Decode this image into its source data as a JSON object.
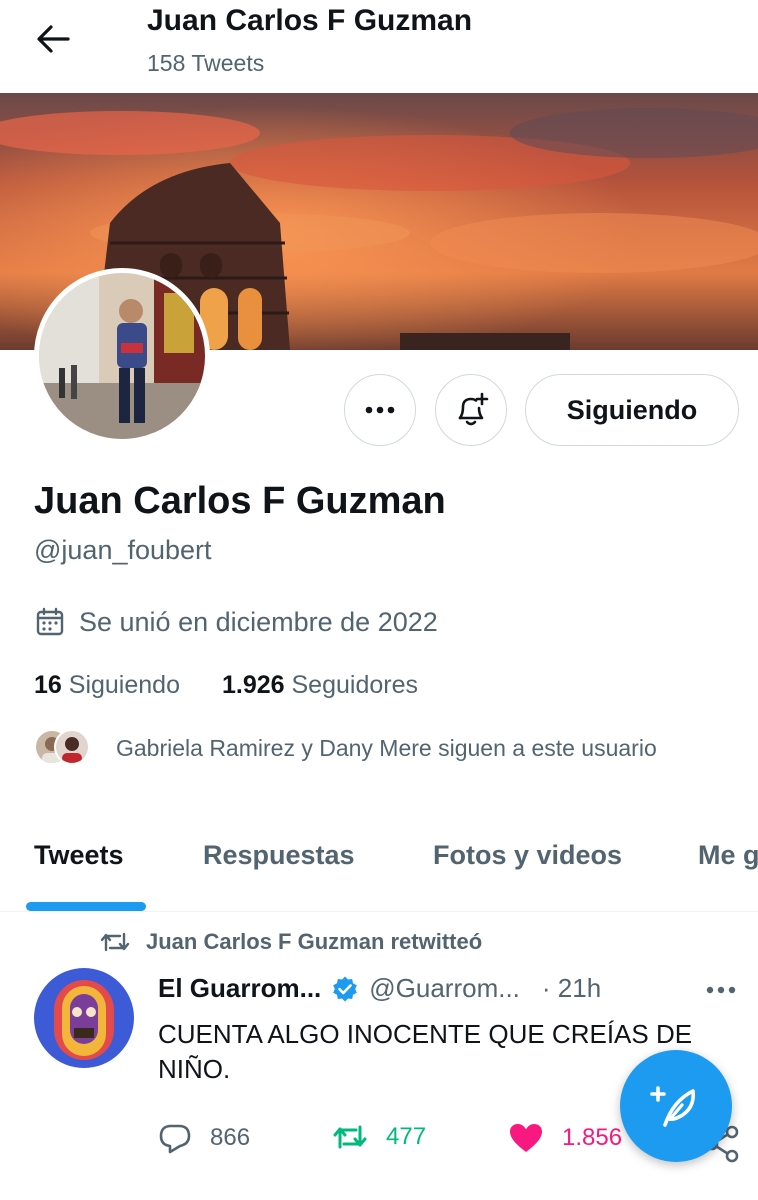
{
  "header": {
    "name": "Juan Carlos F Guzman",
    "tweet_count": "158 Tweets"
  },
  "profile": {
    "name": "Juan Carlos F Guzman",
    "handle": "@juan_foubert",
    "joined": "Se unió en diciembre de 2022",
    "following_count": "16",
    "following_label": "Siguiendo",
    "followers_count": "1.926",
    "followers_label": "Seguidores",
    "mutual_text": "Gabriela Ramirez y Dany Mere siguen a este usuario"
  },
  "actions": {
    "follow_label": "Siguiendo"
  },
  "tabs": [
    {
      "label": "Tweets",
      "active": true
    },
    {
      "label": "Respuestas",
      "active": false
    },
    {
      "label": "Fotos y videos",
      "active": false
    },
    {
      "label": "Me gusta",
      "active": false
    }
  ],
  "tweet": {
    "retweet_label": "Juan Carlos F Guzman retwitteó",
    "author": "El Guarrom...",
    "handle": "@Guarrom...",
    "time": "· 21h",
    "text": "CUENTA ALGO INOCENTE QUE CREÍAS DE NIÑO.",
    "replies": "866",
    "retweets": "477",
    "likes": "1.856"
  },
  "icons": {
    "back": "arrow-left-icon",
    "more": "more-dots-icon",
    "bell": "bell-plus-icon",
    "calendar": "calendar-icon",
    "retweet": "retweet-icon",
    "verified": "verified-badge-icon",
    "reply": "reply-icon",
    "like": "heart-icon",
    "share": "share-icon",
    "compose": "compose-feather-icon"
  },
  "colors": {
    "accent": "#1d9bf0",
    "retweet": "#00ba7c",
    "like": "#f91880",
    "muted": "#536471"
  }
}
